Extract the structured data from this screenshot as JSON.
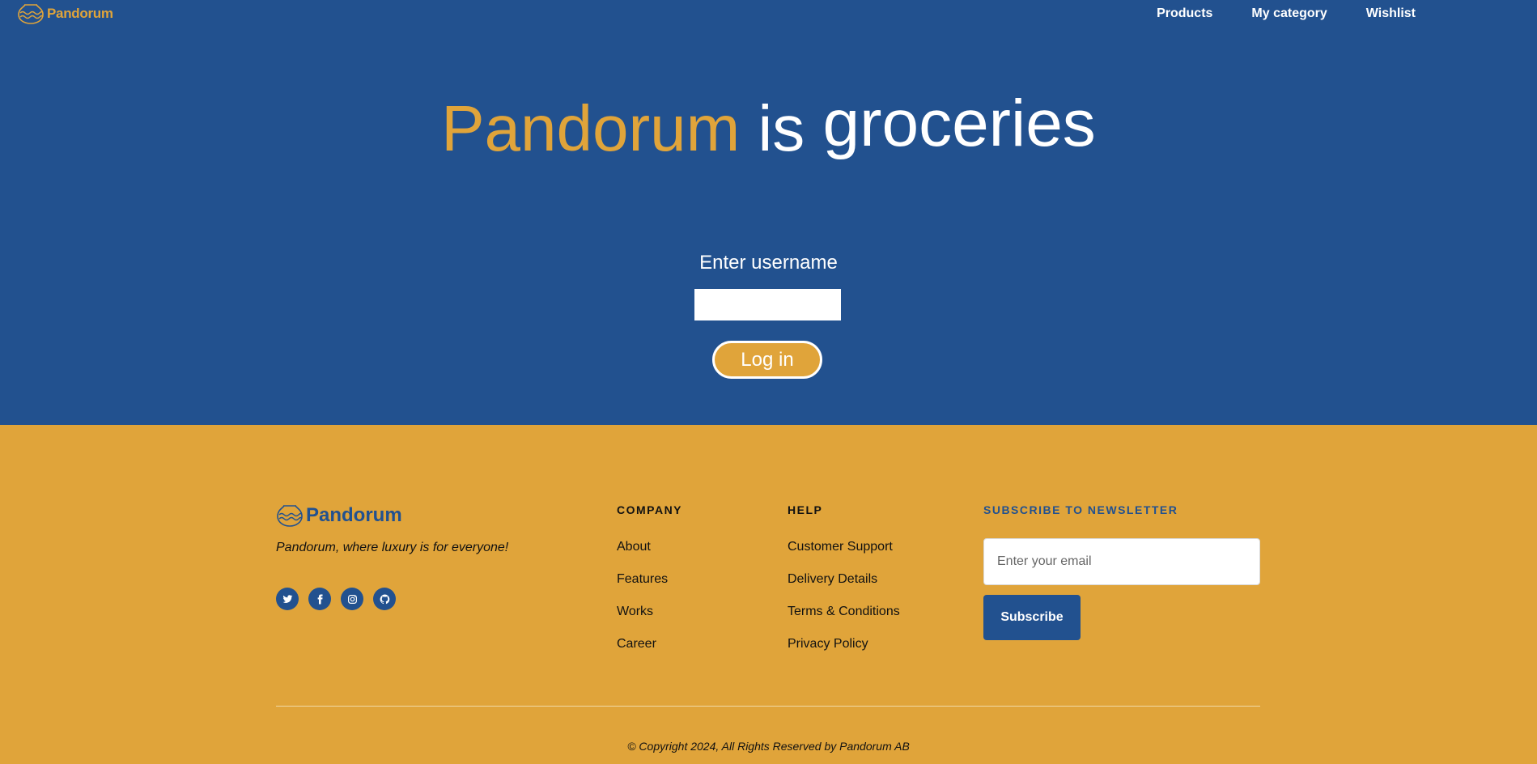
{
  "header": {
    "brand_name": "Pandorum",
    "nav": [
      "Products",
      "My category",
      "Wishlist"
    ]
  },
  "hero": {
    "title_brand": "Pandorum",
    "title_is": "is",
    "title_rest": "groceries"
  },
  "login": {
    "label": "Enter username",
    "username_value": "",
    "button_label": "Log in"
  },
  "footer": {
    "brand_name": "Pandorum",
    "tagline": "Pandorum, where luxury is for everyone!",
    "socials": [
      "twitter-icon",
      "facebook-icon",
      "instagram-icon",
      "github-icon"
    ],
    "company": {
      "heading": "COMPANY",
      "links": [
        "About",
        "Features",
        "Works",
        "Career"
      ]
    },
    "help": {
      "heading": "HELP",
      "links": [
        "Customer Support",
        "Delivery Details",
        "Terms & Conditions",
        "Privacy Policy"
      ]
    },
    "newsletter": {
      "heading": "SUBSCRIBE TO NEWSLETTER",
      "email_placeholder": "Enter your email",
      "button_label": "Subscribe"
    },
    "copyright": "© Copyright 2024, All Rights Reserved by Pandorum AB"
  },
  "colors": {
    "primary_blue": "#22518f",
    "accent_gold": "#e0a43a",
    "white": "#ffffff"
  }
}
